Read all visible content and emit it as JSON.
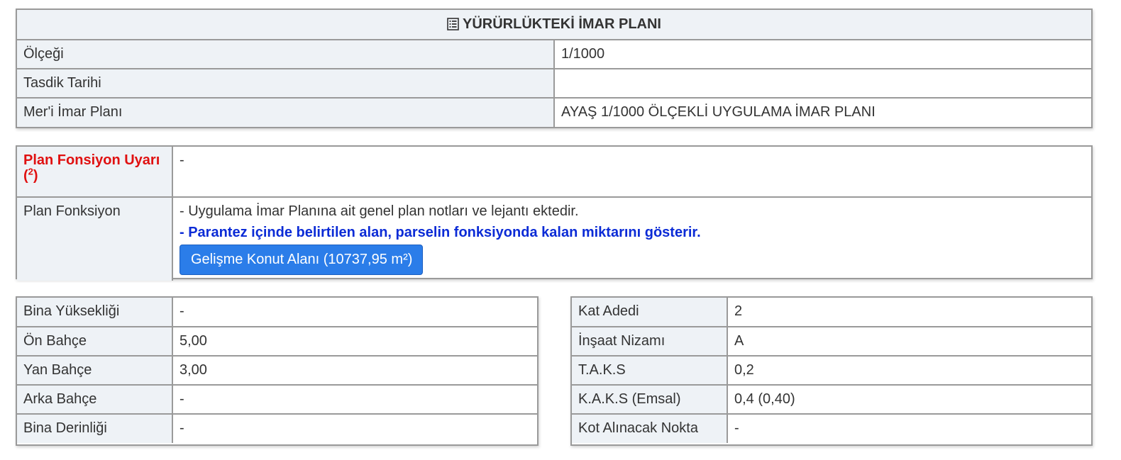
{
  "plan": {
    "title": "YÜRÜRLÜKTEKİ İMAR PLANI",
    "title_icon": "list-alt-icon",
    "rows": [
      {
        "label": "Ölçeği",
        "value": "1/1000"
      },
      {
        "label": "Tasdik Tarihi",
        "value": ""
      },
      {
        "label": "Mer'i İmar Planı",
        "value": "AYAŞ 1/1000 ÖLÇEKLİ UYGULAMA İMAR PLANI"
      }
    ]
  },
  "function": {
    "warning_label": "Plan Fonsiyon Uyarı",
    "warning_sup": "2",
    "warning_open": "(",
    "warning_close": ")",
    "warning_value": "-",
    "function_label": "Plan Fonksiyon",
    "note": "- Uygulama İmar Planına ait genel plan notları ve lejantı ektedir.",
    "note_bold": "- Parantez içinde belirtilen alan, parselin fonksiyonda kalan miktarını gösterir.",
    "button_label": "Gelişme Konut Alanı (10737,95 m²)"
  },
  "left_table": [
    {
      "label": "Bina Yüksekliği",
      "value": "-"
    },
    {
      "label": "Ön Bahçe",
      "value": "5,00"
    },
    {
      "label": "Yan Bahçe",
      "value": "3,00"
    },
    {
      "label": "Arka Bahçe",
      "value": "-"
    },
    {
      "label": "Bina Derinliği",
      "value": "-"
    }
  ],
  "right_table": [
    {
      "label": "Kat Adedi",
      "value": "2"
    },
    {
      "label": "İnşaat Nizamı",
      "value": "A"
    },
    {
      "label": "T.A.K.S",
      "value": "0,2"
    },
    {
      "label": "K.A.K.S (Emsal)",
      "value": "0,4 (0,40)"
    },
    {
      "label": "Kot Alınacak Nokta",
      "value": "-"
    }
  ],
  "colors": {
    "label_bg": "#eef2f6",
    "border": "#9a9a9a",
    "warning": "#e01010",
    "note_blue": "#0b2bd6",
    "button_bg": "#2b7de9"
  }
}
